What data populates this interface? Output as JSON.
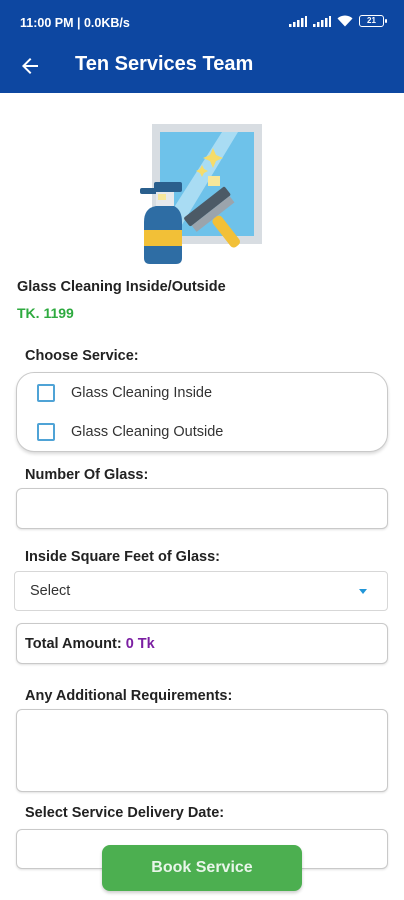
{
  "status_bar": {
    "time": "11:00 PM | 0.0KB/s",
    "battery": "21"
  },
  "toolbar": {
    "back_icon": "arrow-left-icon",
    "title": "Ten Services Team"
  },
  "hero_image": "glass-cleaning-illustration",
  "product": {
    "name": "Glass Cleaning Inside/Outside",
    "price": "TK. 1199"
  },
  "choose_service": {
    "label": "Choose Service:",
    "options": [
      {
        "label": "Glass Cleaning Inside",
        "checked": false
      },
      {
        "label": "Glass Cleaning Outside",
        "checked": false
      }
    ]
  },
  "number_of_glass": {
    "label": "Number Of Glass:",
    "value": ""
  },
  "square_feet": {
    "label": "Inside Square Feet of Glass:",
    "selected": "Select"
  },
  "total": {
    "label": "Total Amount:",
    "value": "0 Tk"
  },
  "additional": {
    "label": "Any Additional Requirements:",
    "value": ""
  },
  "delivery_date": {
    "label": "Select Service Delivery Date:"
  },
  "book_button": "Book Service",
  "colors": {
    "appbar": "#0d47a1",
    "price": "#2eaa3f",
    "total_value": "#7b1fa2",
    "button": "#4caf50",
    "checkbox": "#4fa3d6"
  }
}
